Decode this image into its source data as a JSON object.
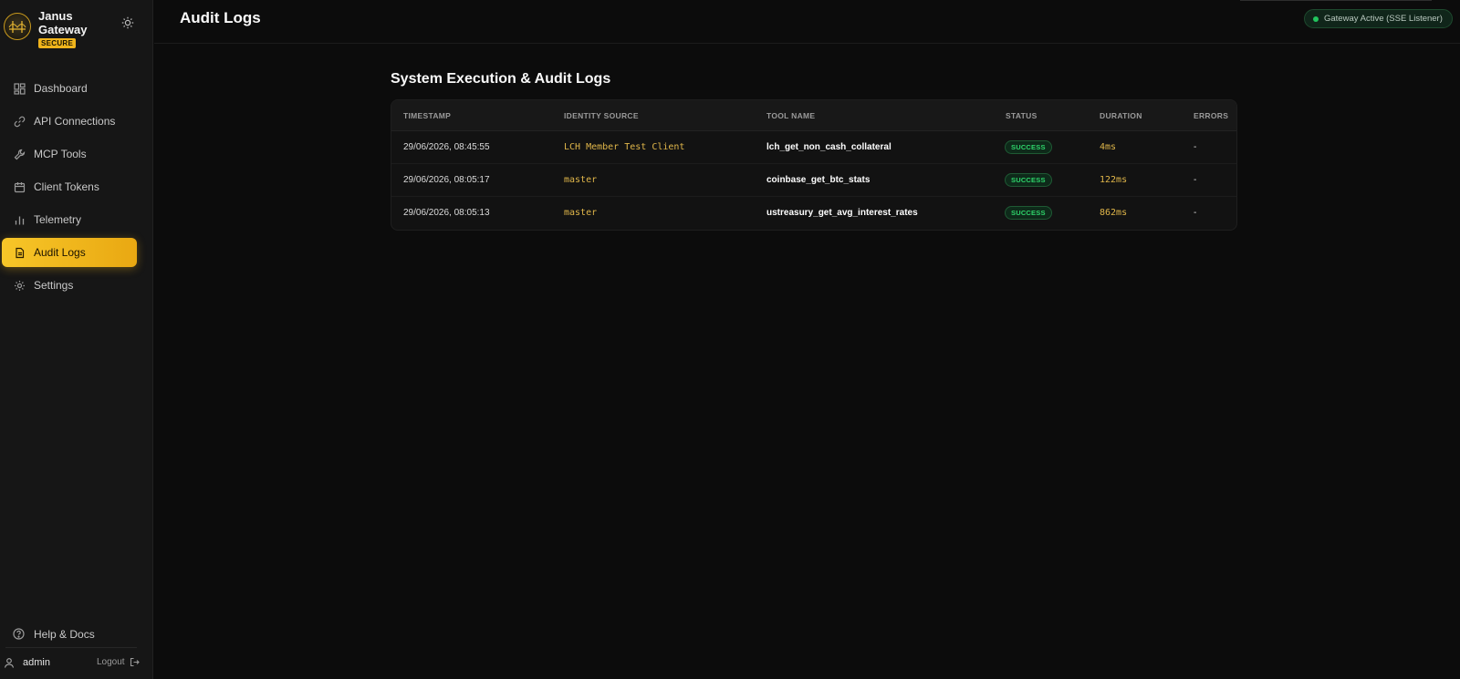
{
  "brand": {
    "name": "Janus Gateway",
    "badge": "SECURE"
  },
  "sidebar": {
    "items": [
      {
        "label": "Dashboard",
        "icon": "dashboard-icon"
      },
      {
        "label": "API Connections",
        "icon": "link-icon"
      },
      {
        "label": "MCP Tools",
        "icon": "wrench-icon"
      },
      {
        "label": "Client Tokens",
        "icon": "calendar-icon"
      },
      {
        "label": "Telemetry",
        "icon": "bar-chart-icon"
      },
      {
        "label": "Audit Logs",
        "icon": "document-icon",
        "active": true
      },
      {
        "label": "Settings",
        "icon": "gear-icon"
      }
    ],
    "help": "Help & Docs",
    "user": "admin",
    "logout": "Logout"
  },
  "header": {
    "title": "Audit Logs",
    "status": "Gateway Active (SSE Listener)"
  },
  "main": {
    "section_title": "System Execution & Audit Logs",
    "columns": [
      "TIMESTAMP",
      "IDENTITY SOURCE",
      "TOOL NAME",
      "STATUS",
      "DURATION",
      "ERRORS"
    ],
    "rows": [
      {
        "timestamp": "29/06/2026, 08:45:55",
        "identity": "LCH Member Test Client",
        "tool": "lch_get_non_cash_collateral",
        "status": "SUCCESS",
        "duration": "4ms",
        "errors": "-"
      },
      {
        "timestamp": "29/06/2026, 08:05:17",
        "identity": "master",
        "tool": "coinbase_get_btc_stats",
        "status": "SUCCESS",
        "duration": "122ms",
        "errors": "-"
      },
      {
        "timestamp": "29/06/2026, 08:05:13",
        "identity": "master",
        "tool": "ustreasury_get_avg_interest_rates",
        "status": "SUCCESS",
        "duration": "862ms",
        "errors": "-"
      }
    ]
  },
  "colors": {
    "accent": "#f0b41c",
    "success": "#22c55e",
    "background": "#0c0c0c"
  }
}
